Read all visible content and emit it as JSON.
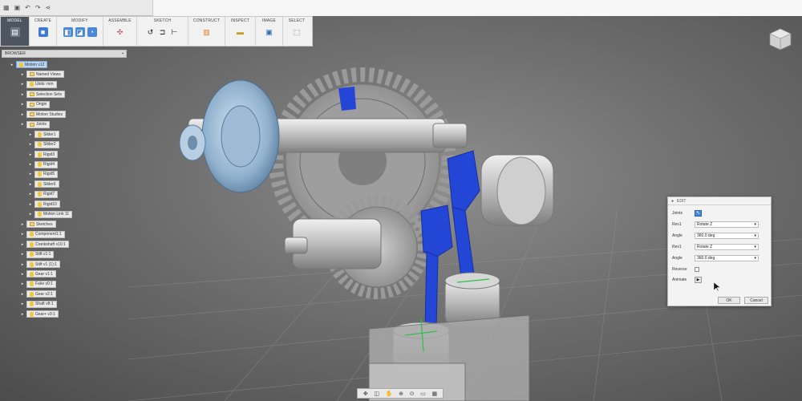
{
  "toolbar": {
    "workspace": "MODEL",
    "groups": [
      {
        "label": "CREATE"
      },
      {
        "label": "MODIFY"
      },
      {
        "label": "ASSEMBLE"
      },
      {
        "label": "SKETCH"
      },
      {
        "label": "CONSTRUCT"
      },
      {
        "label": "INSPECT"
      },
      {
        "label": "IMAGE"
      },
      {
        "label": "SELECT"
      }
    ]
  },
  "browser": {
    "title": "BROWSER",
    "items": [
      {
        "label": "Motion v12"
      },
      {
        "label": "Named Views"
      },
      {
        "label": "Units: mm"
      },
      {
        "label": "Selection Sets"
      },
      {
        "label": "Origin"
      },
      {
        "label": "Motion Studies"
      },
      {
        "label": "Joints"
      },
      {
        "label": "Slider1"
      },
      {
        "label": "Slider2"
      },
      {
        "label": "Rigid3"
      },
      {
        "label": "Rigid4"
      },
      {
        "label": "Rigid5"
      },
      {
        "label": "Slider6"
      },
      {
        "label": "Rigid7"
      },
      {
        "label": "Rigid10"
      },
      {
        "label": "Motion Link 11"
      },
      {
        "label": "Sketches"
      },
      {
        "label": "Component1:1"
      },
      {
        "label": "Crankshaft v10:1"
      },
      {
        "label": "Stift v1:1"
      },
      {
        "label": "Stift v1 (1):1"
      },
      {
        "label": "Gear v1:1"
      },
      {
        "label": "Fake v0:1"
      },
      {
        "label": "Gear v2:1"
      },
      {
        "label": "Shaft v8:1"
      },
      {
        "label": "Gear+ v3:1"
      }
    ]
  },
  "dialog": {
    "title": "EDIT",
    "joints_label": "Joints",
    "rev1_label": "Rev1",
    "rev1_value": "Rotate Z",
    "angle1_label": "Angle",
    "angle1_value": "360.0 deg",
    "rev2_label": "Rev1",
    "rev2_value": "Rotate Z",
    "angle2_label": "Angle",
    "angle2_value": "360.0 deg",
    "reverse_label": "Reverse",
    "animate_label": "Animate",
    "ok_label": "OK",
    "cancel_label": "Cancel"
  },
  "colors": {
    "joint_blue": "#2446d6",
    "metal": "#c4c4c4",
    "accent_selection": "#bcd5f3"
  }
}
